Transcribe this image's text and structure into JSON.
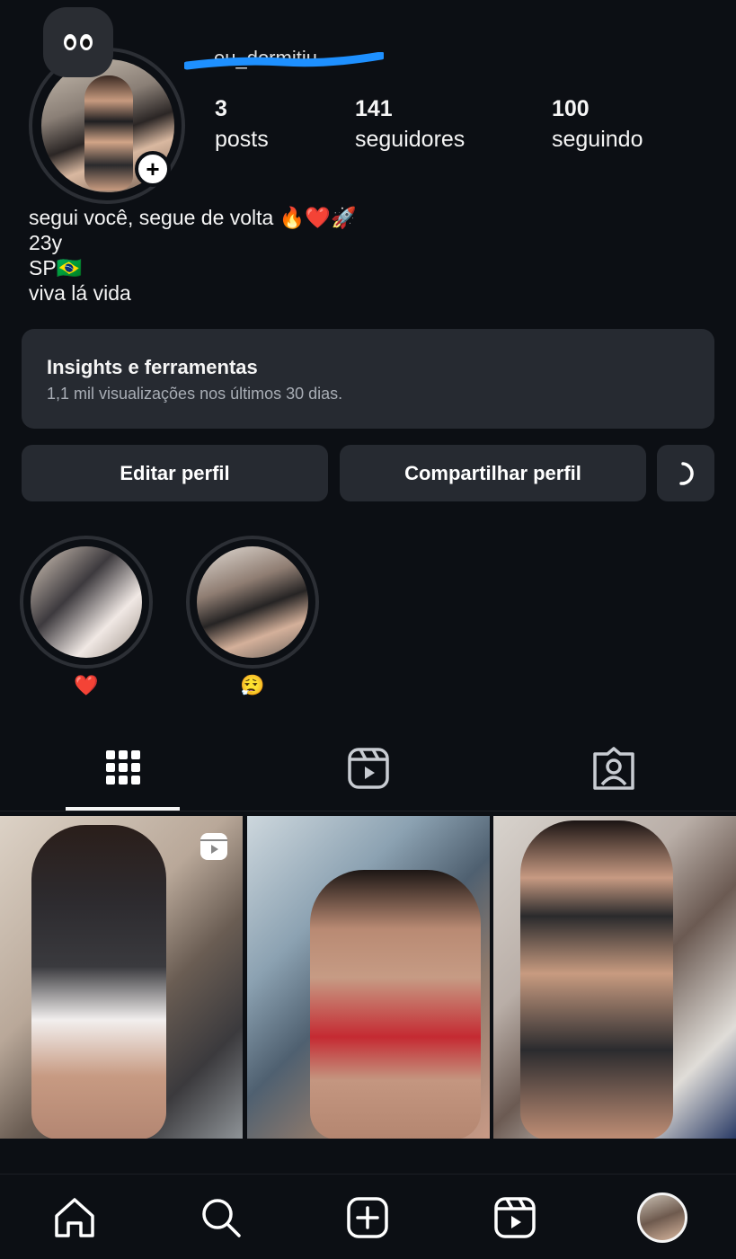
{
  "profile": {
    "username": "eu_dormitiu",
    "stats": [
      {
        "value": "3",
        "label": "posts"
      },
      {
        "value": "141",
        "label": "seguidores"
      },
      {
        "value": "100",
        "label": "seguindo"
      }
    ],
    "bio": [
      "segui você, segue de volta 🔥❤️🚀",
      "23y",
      "SP🇧🇷",
      "viva lá vida"
    ]
  },
  "insights": {
    "title": "Insights e ferramentas",
    "subtitle": "1,1 mil visualizações nos últimos 30 dias."
  },
  "actions": {
    "edit": "Editar perfil",
    "share": "Compartilhar perfil"
  },
  "highlights": [
    {
      "label": "❤️"
    },
    {
      "label": "😮‍💨"
    }
  ],
  "tabs": {
    "active": "grid",
    "items": [
      "grid-icon",
      "reels-icon",
      "tagged-icon"
    ]
  },
  "nav": {
    "items": [
      "home-icon",
      "search-icon",
      "create-icon",
      "reels-icon",
      "profile-avatar"
    ]
  },
  "colors": {
    "background": "#0c0f14",
    "card": "#262a31",
    "scribble": "#1e90ff"
  }
}
